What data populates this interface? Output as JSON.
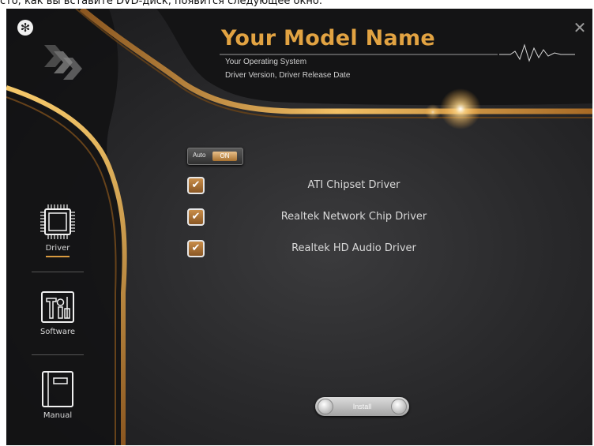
{
  "caption": "сто, как вы вставите DVD-диск, появится следующее окно:",
  "header": {
    "model_name": "Your Model Name",
    "operating_system": "Your Operating System",
    "driver_info": "Driver Version, Driver Release Date"
  },
  "toggle": {
    "label": "Auto",
    "state": "ON"
  },
  "drivers": [
    {
      "label": "ATI Chipset Driver",
      "checked": true
    },
    {
      "label": "Realtek Network Chip Driver",
      "checked": true
    },
    {
      "label": "Realtek HD Audio Driver",
      "checked": true
    }
  ],
  "checkmark": "✔",
  "nav": {
    "driver": "Driver",
    "software": "Software",
    "manual": "Manual"
  },
  "install": {
    "label": "Install"
  },
  "icons": {
    "app_logo": "fan-icon",
    "close": "close-icon",
    "chevrons": "chevron-icon",
    "pulse": "pulse-line-icon",
    "driver": "chip-icon",
    "software": "tools-icon",
    "manual": "book-icon"
  },
  "colors": {
    "accent_gold": "#e2a342",
    "background": "#2a2a2c",
    "checkbox_fill": "#a96f33"
  }
}
